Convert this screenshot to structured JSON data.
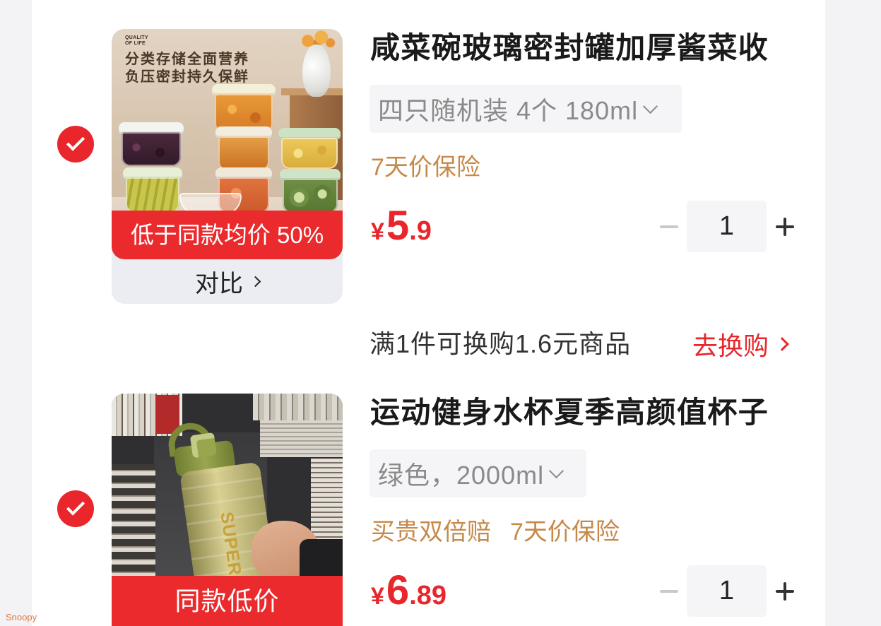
{
  "theme": {
    "accent": "#e8262b",
    "banner": "#ea2a2c",
    "tag": "#c7894a",
    "muted": "#8a8a8a",
    "watermark": "#e5733d"
  },
  "icons": {
    "checkbox": "check-icon",
    "spec_dropdown": "chevron-down-icon",
    "compare": "chevron-right-icon",
    "decrease": "minus-icon",
    "increase": "plus-icon",
    "exchange": "chevron-right-icon"
  },
  "items": [
    {
      "selected": true,
      "title": "咸菜碗玻璃密封罐加厚酱菜收",
      "spec": "四只随机装 4个 180ml",
      "tags": [
        "7天价保险"
      ],
      "price": {
        "currency": "¥",
        "integer": "5",
        "decimal": ".9"
      },
      "quantity": "1",
      "image": {
        "brand_lines": [
          "QUALITY",
          "OF LIFE"
        ],
        "headline": [
          "分类存储全面营养",
          "负压密封持久保鲜"
        ],
        "banner": "低于同款均价 50%"
      },
      "compare_label": "对比"
    },
    {
      "selected": true,
      "title": "运动健身水杯夏季高颜值杯子",
      "spec": "绿色，2000ml",
      "tags": [
        "买贵双倍赔",
        "7天价保险"
      ],
      "price": {
        "currency": "¥",
        "integer": "6",
        "decimal": ".89"
      },
      "quantity": "1",
      "image": {
        "bottle_print": "SUPER",
        "banner": "同款低价"
      }
    }
  ],
  "exchange": {
    "text": "满1件可换购1.6元商品",
    "action": "去换购"
  },
  "watermark": "Snoopy"
}
